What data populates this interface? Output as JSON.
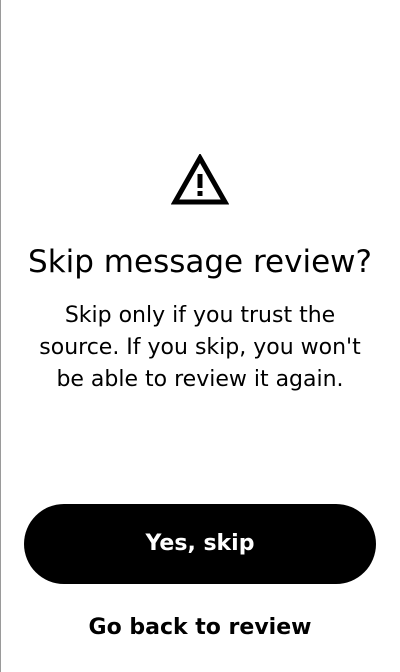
{
  "dialog": {
    "icon": "warning-icon",
    "title": "Skip message review?",
    "body_lines": [
      "Skip only if you trust the",
      "source. If you skip, you won't",
      "be able to review it again."
    ]
  },
  "actions": {
    "primary_label": "Yes, skip",
    "secondary_label": "Go back to review"
  },
  "colors": {
    "background": "#ffffff",
    "text": "#000000",
    "primary_button": "#000000",
    "primary_button_text": "#ffffff"
  }
}
